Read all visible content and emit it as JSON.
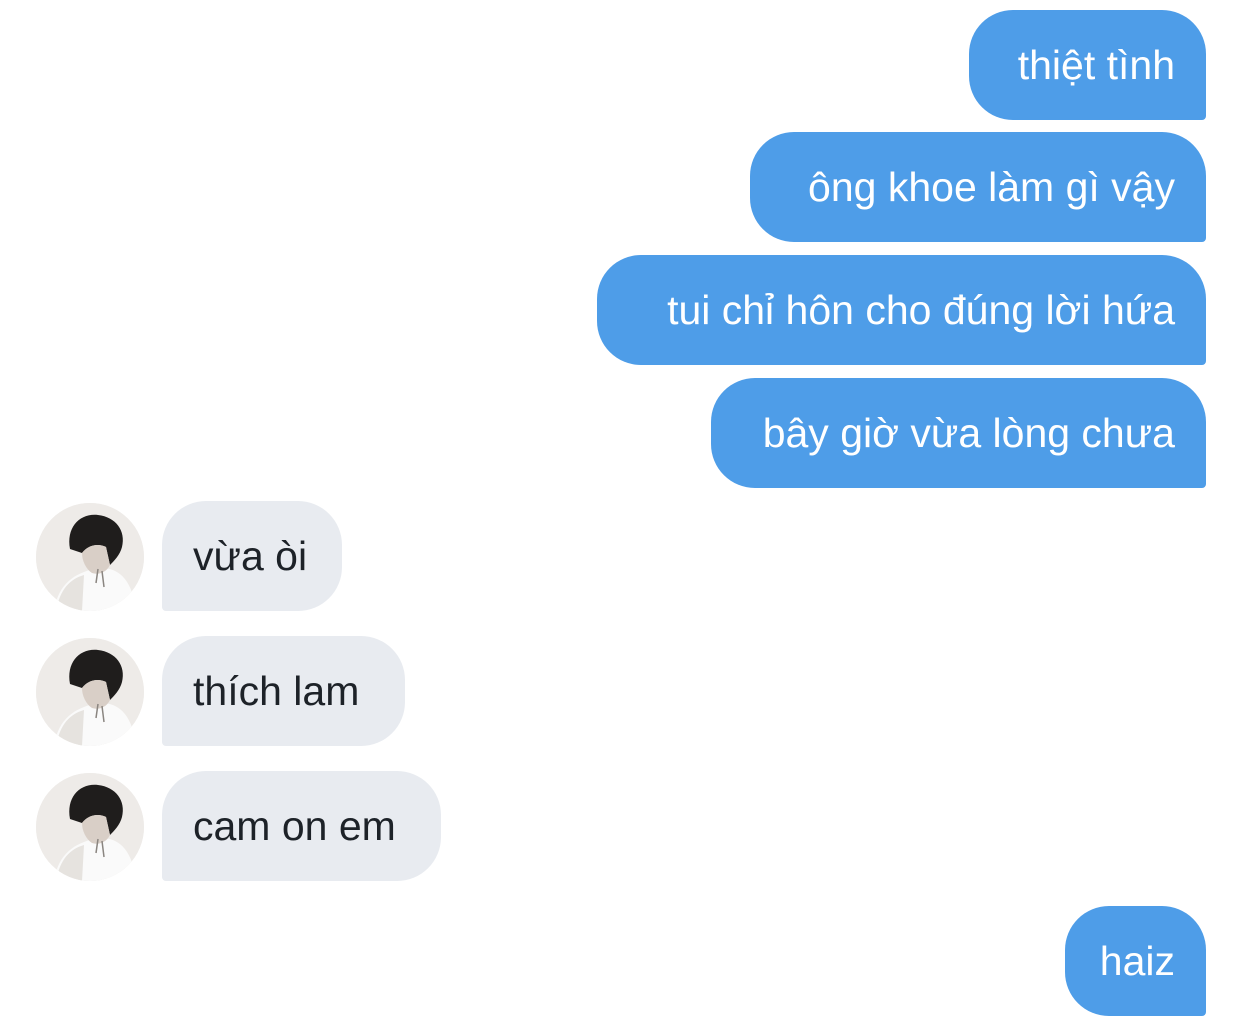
{
  "conversation": {
    "outgoing": [
      {
        "text": "thiệt tình"
      },
      {
        "text": "ông khoe làm gì vậy"
      },
      {
        "text": "tui chỉ hôn cho đúng lời hứa"
      },
      {
        "text": "bây giờ vừa lòng chưa"
      },
      {
        "text": "haiz"
      }
    ],
    "incoming": [
      {
        "text": "vừa òi"
      },
      {
        "text": "thích lam"
      },
      {
        "text": "cam on em"
      }
    ]
  },
  "colors": {
    "outgoing_bubble": "#4e9de8",
    "incoming_bubble": "#e8ebf0",
    "outgoing_text": "#ffffff",
    "incoming_text": "#1d2228"
  },
  "icons": {
    "avatar": "user-photo-avatar"
  }
}
